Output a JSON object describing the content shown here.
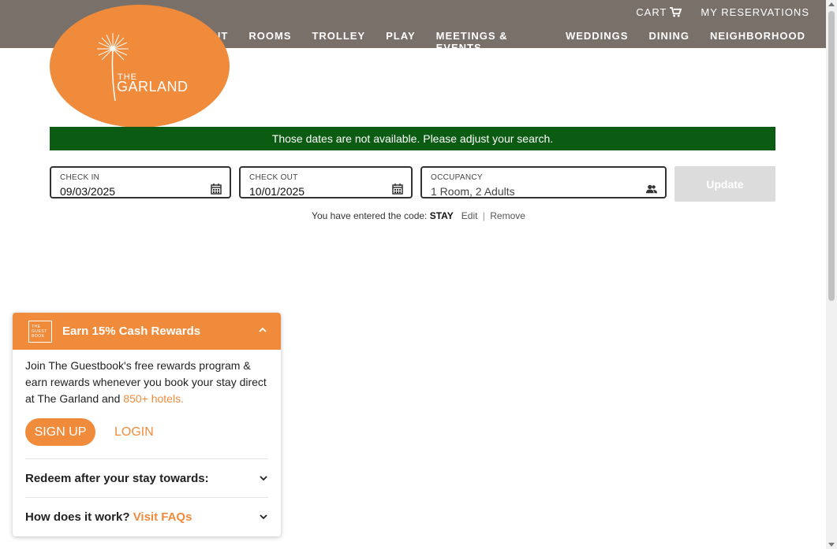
{
  "header": {
    "cart_label": "CART",
    "reservations_label": "MY RESERVATIONS",
    "nav": [
      "UT",
      "ROOMS",
      "TROLLEY",
      "PLAY",
      "MEETINGS & EVENTS",
      "WEDDINGS",
      "DINING",
      "NEIGHBORHOOD"
    ]
  },
  "logo": {
    "line1": "THE",
    "line2": "GARLAND"
  },
  "alert": {
    "message": "Those dates are not available. Please adjust your search."
  },
  "search": {
    "check_in_label": "CHECK IN",
    "check_in_value": "09/03/2025",
    "check_out_label": "CHECK OUT",
    "check_out_value": "10/01/2025",
    "occupancy_label": "OCCUPANCY",
    "occupancy_value": "1 Room, 2 Adults",
    "update_label": "Update"
  },
  "promo": {
    "prefix": "You have entered the code:",
    "code": "STAY",
    "edit_label": "Edit",
    "remove_label": "Remove"
  },
  "rewards": {
    "logo_text": "THE GUEST BOOK",
    "title": "Earn 15% Cash Rewards",
    "body_text": "Join The Guestbook's free rewards program & earn rewards whenever you book your stay direct at The Garland and ",
    "body_link": "850+ hotels.",
    "signup_label": "SIGN UP",
    "login_label": "LOGIN",
    "redeem_label": "Redeem after your stay towards:",
    "how_label": "How does it work?",
    "faq_label": "Visit FAQs"
  },
  "colors": {
    "accent": "#f08b3c",
    "header_bg": "#7a706a",
    "alert_bg": "#0b5c12"
  }
}
